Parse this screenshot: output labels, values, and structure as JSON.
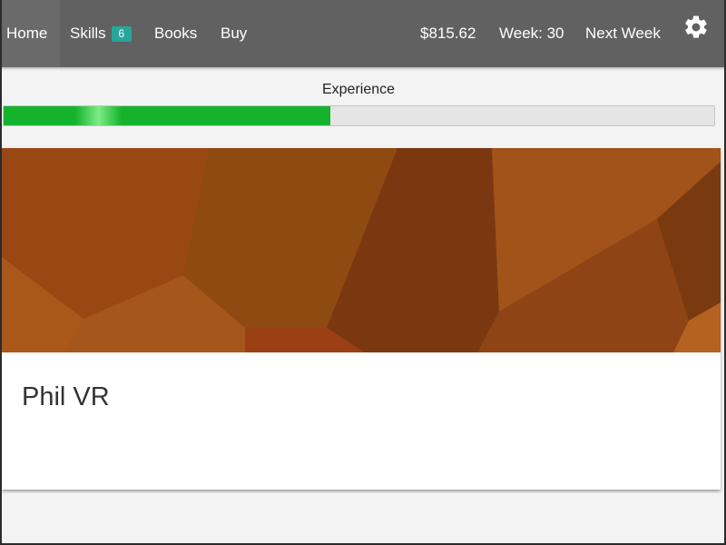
{
  "nav": {
    "home": "Home",
    "skills": "Skills",
    "skills_badge": "6",
    "books": "Books",
    "buy": "Buy",
    "money": "$815.62",
    "week": "Week: 30",
    "next_week": "Next Week",
    "settings_icon": "gear-icon"
  },
  "experience": {
    "label": "Experience",
    "progress": 0.46,
    "fill_color": "#15b22d"
  },
  "card": {
    "title": "Phil VR",
    "image": "brown-polygon-pattern"
  },
  "colors": {
    "navbar": "#616161",
    "badge": "#26a69a",
    "background": "#f3f3f3"
  }
}
